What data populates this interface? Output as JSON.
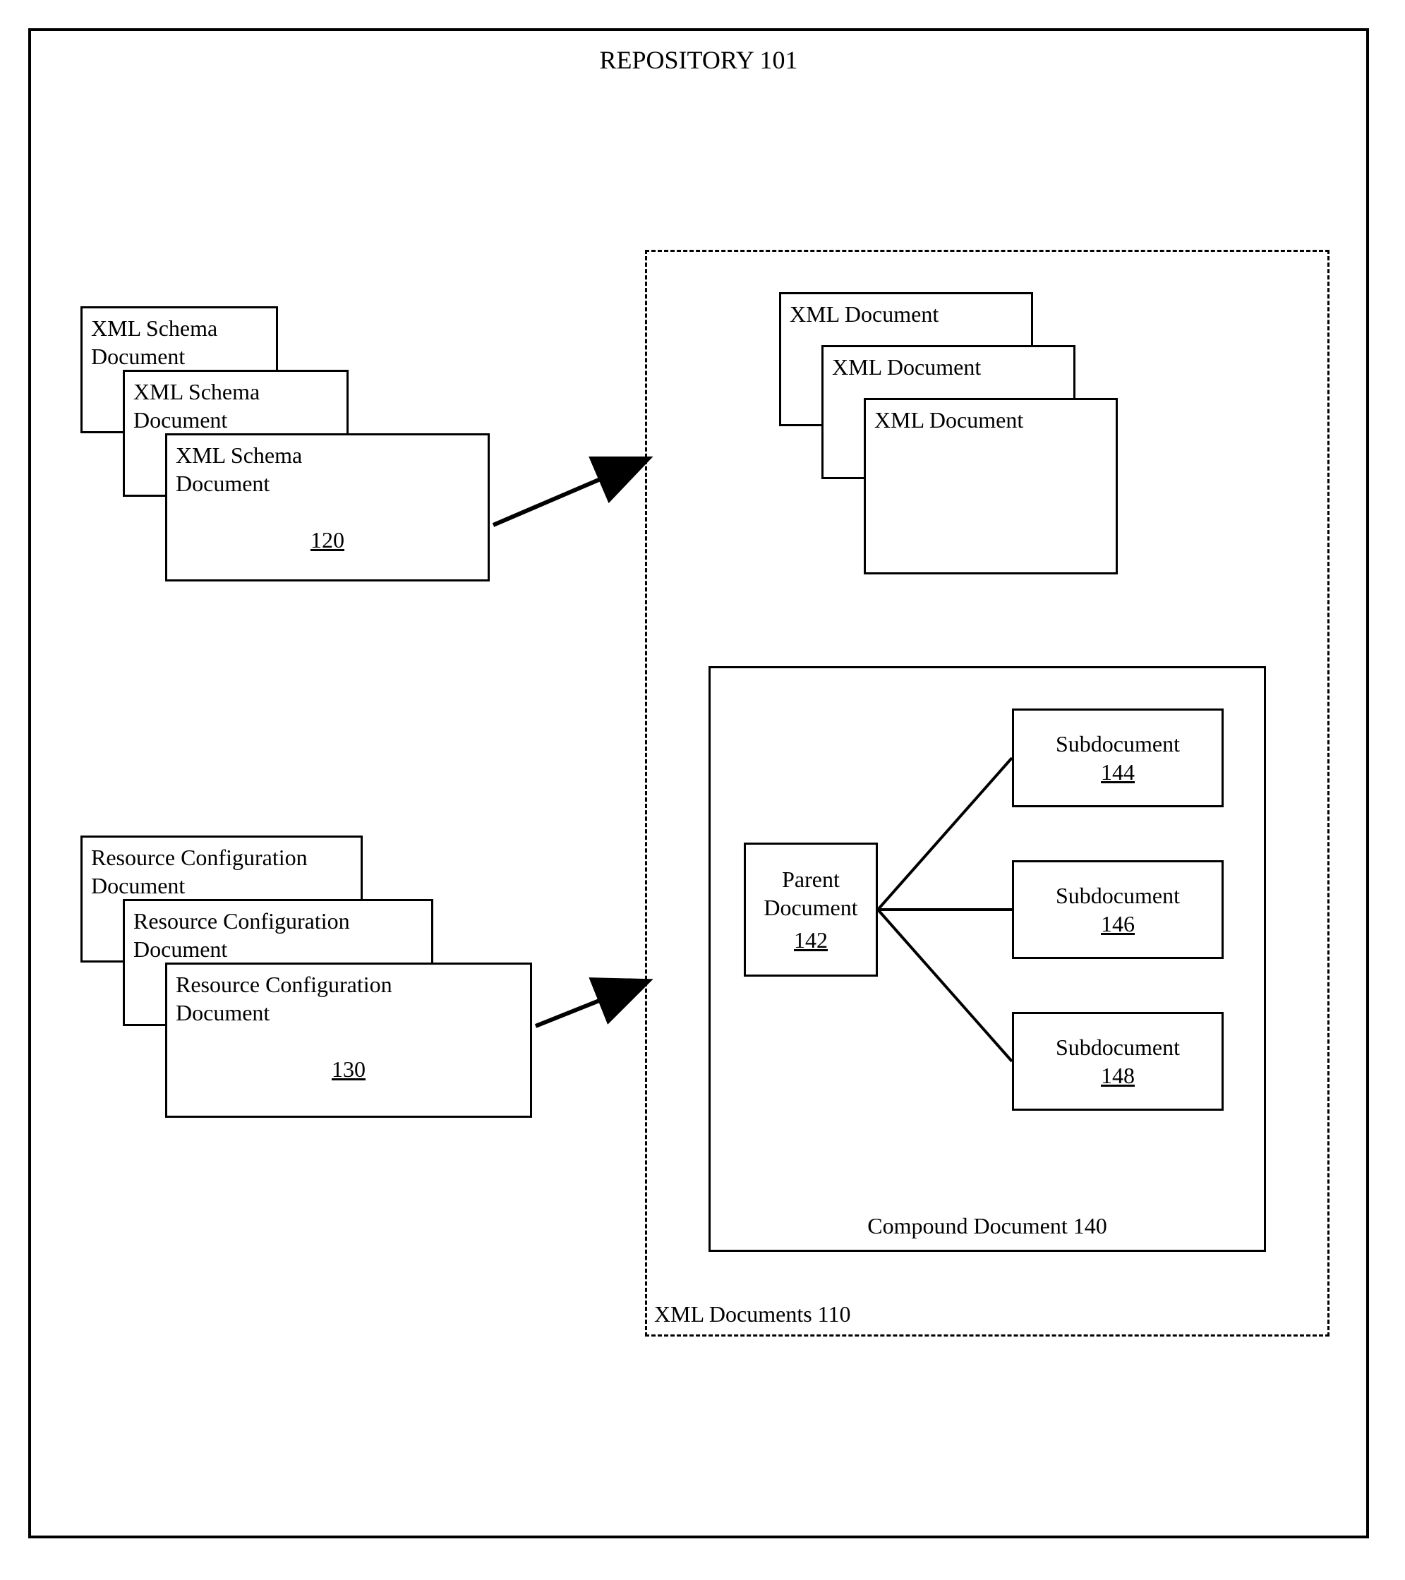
{
  "title": "REPOSITORY 101",
  "schema": {
    "label1": "XML Schema Document",
    "label2": "XML Schema Document",
    "label3": "XML Schema Document",
    "num": "120"
  },
  "resconf": {
    "label1": "Resource Configuration Document",
    "label2": "Resource Configuration Document",
    "label3": "Resource Configuration Document",
    "num": "130"
  },
  "xmldocsLabel": "XML Documents 110",
  "xmlStack": {
    "label1": "XML Document",
    "label2": "XML Document",
    "label3": "XML Document"
  },
  "compound": {
    "caption": "Compound Document 140",
    "parent": {
      "label": "Parent Document",
      "num": "142"
    },
    "sub1": {
      "label": "Subdocument",
      "num": "144"
    },
    "sub2": {
      "label": "Subdocument",
      "num": "146"
    },
    "sub3": {
      "label": "Subdocument",
      "num": "148"
    }
  }
}
